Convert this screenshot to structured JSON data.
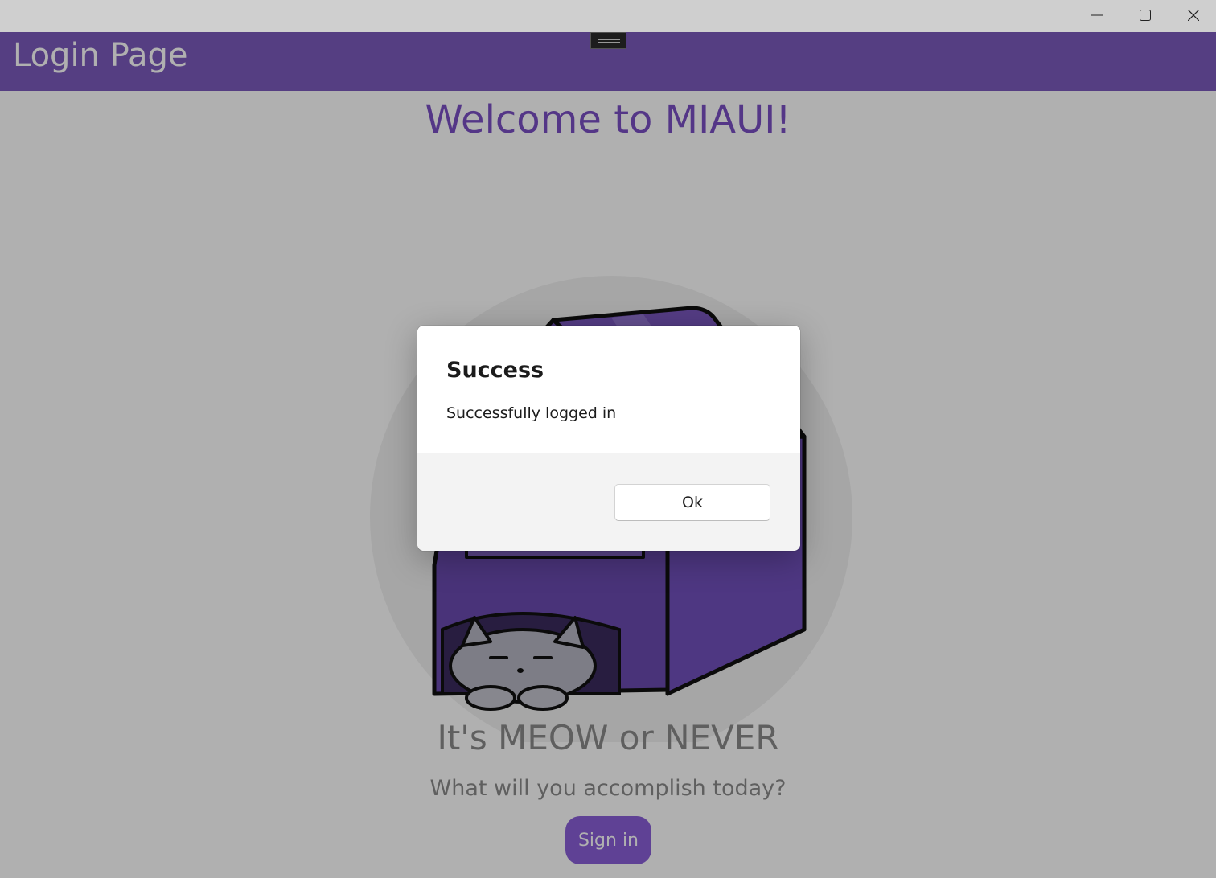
{
  "window": {
    "minimize_icon": "minimize-icon",
    "maximize_icon": "maximize-icon",
    "close_icon": "close-icon"
  },
  "header": {
    "title": "Login Page",
    "color": "#7c5bbd"
  },
  "main": {
    "welcome": "Welcome to MIAUI!",
    "tagline": "It's MEOW or NEVER",
    "subtitle": "What will you accomplish today?",
    "signin_label": "Sign in",
    "accent": "#7a4fc4"
  },
  "dialog": {
    "title": "Success",
    "message": "Successfully logged in",
    "ok_label": "Ok"
  }
}
